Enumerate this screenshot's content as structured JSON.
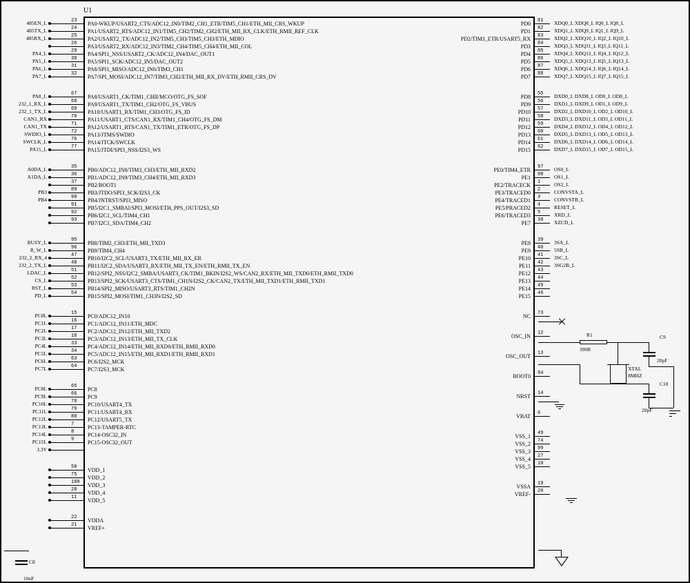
{
  "chip_ref": "U1",
  "left_pins": [
    {
      "net": "485EN_L",
      "pin": "23",
      "label": "PA0-WKUP/USART2_CTS/ADC12_IN0/TIM2_CH1_ETR/TIM5_CH1/ETH_MII_CRS_WKUP"
    },
    {
      "net": "485TX_L",
      "pin": "24",
      "label": "PA1/USART2_RTS/ADC12_IN1/TIM5_CH2/TIM2_CH2/ETH_MII_RX_CLK/ETH_RMII_REF_CLK"
    },
    {
      "net": "485RX_L",
      "pin": "25",
      "label": "PA2/USART2_TX/ADC12_IN2/TIM5_CH3/TIM5_CH3/ETH_MDIO"
    },
    {
      "net": "",
      "pin": "26",
      "label": "PA3/USART2_RX/ADC12_IN3/TIM2_CH4/TIM5_CH4/ETH_MII_COL"
    },
    {
      "net": "PA4_L",
      "pin": "29",
      "label": "PA4/SPI1_NSS/USART2_CK/ADC12_IN4/DAC_OUT1"
    },
    {
      "net": "PA5_L",
      "pin": "30",
      "label": "PA5/SPI1_SCK/ADC12_IN5/DAC_OUT2"
    },
    {
      "net": "PA6_L",
      "pin": "31",
      "label": "PA6/SPI1_MISO/ADC12_IN6/TIM3_CH1"
    },
    {
      "net": "PA7_L",
      "pin": "32",
      "label": "PA7/SPI_MOSI/ADC12_IN7/TIM3_CH2/ETH_MII_RX_DV/ETH_RMII_CRS_DV"
    },
    {
      "gap": true
    },
    {
      "net": "PA8_L",
      "pin": "67",
      "label": "PA8/USART1_CK/TIM1_CHII/MCO/OTG_FS_SOF"
    },
    {
      "net": "232_1_RX_L",
      "pin": "68",
      "label": "PA9/USART1_TX/TIM1_CH2/OTG_FS_VBUS"
    },
    {
      "net": "232_1_TX_L",
      "pin": "69",
      "label": "PA10/USART1_RX/TIM1_CH3/OTG_FS_ID"
    },
    {
      "net": "CAN1_RX",
      "pin": "70",
      "label": "PA11/USART1_CTS/CAN1_RX/TIM1_CH4/OTG_FS_DM"
    },
    {
      "net": "CAN1_TX",
      "pin": "71",
      "label": "PA12/USART1_RTS/CAN1_TX/TIM1_ETR/OTG_FS_DP"
    },
    {
      "net": "SWDIO_L",
      "pin": "72",
      "label": "PA13/JTMS/SWDIO"
    },
    {
      "net": "SWCLK_L",
      "pin": "76",
      "label": "PA14/JTCK/SWCLK"
    },
    {
      "net": "PA15_L",
      "pin": "77",
      "label": "PA15/JTDI/SPI3_NSS/I2S3_WS"
    },
    {
      "gap": true
    },
    {
      "net": "A0DA_L",
      "pin": "35",
      "label": "PB0/ADC12_IN8/TIM3_CH3/ETH_MII_RXD2"
    },
    {
      "net": "A1DA_L",
      "pin": "36",
      "label": "PB1/ADC12_IN9/TIM3_CH4/ETH_MII_RXD3"
    },
    {
      "net": "",
      "pin": "37",
      "label": "PB2/BOOT1"
    },
    {
      "net": "PB3",
      "pin": "89",
      "label": "PB3/JTDO/SPI3_SCK/I2S3_CK"
    },
    {
      "net": "PB4",
      "pin": "90",
      "label": "PB4/JNTRST/SPI3_MISO"
    },
    {
      "net": "",
      "pin": "91",
      "label": "PB5/I2C1_SMBAI/SPI3_MOSI/ETH_PPS_OUT/I2S3_SD"
    },
    {
      "net": "",
      "pin": "92",
      "label": "PB6/I2C1_SCL/TIM4_CH1"
    },
    {
      "net": "",
      "pin": "93",
      "label": "PB7/I2C1_SDA/TIM4_CH2"
    },
    {
      "gap": true
    },
    {
      "net": "BUSY_L",
      "pin": "95",
      "label": "PB8/TIM2_CH3/ETH_MII_TXD3"
    },
    {
      "net": "R_W_L",
      "pin": "96",
      "label": "PB9/TIM4_CH4"
    },
    {
      "net": "232_2_RX_4",
      "pin": "47",
      "label": "PB10/I2C2_SCL/USART3_TX/ETH_MII_RX_ER"
    },
    {
      "net": "232_2_TX_L",
      "pin": "48",
      "label": "PB11/I2C2_SDA/USART3_RX/ETH_MII_TX_EN/ETH_RMII_TX_EN"
    },
    {
      "net": "LDAC_L",
      "pin": "51",
      "label": "PB12/SPI2_NSS/I2C2_SMBA/USART3_CK/TIM1_BKIN/I2S2_WS/CAN2_RX/ETH_MII_TXD0/ETH_RMII_TXD0"
    },
    {
      "net": "CS_L",
      "pin": "52",
      "label": "PB13/SPI2_SCK/USART3_CTS/TIM1_CH1N/I2S2_CK/CAN2_TX/ETH_MII_TXD1/ETH_RMII_TXD1"
    },
    {
      "net": "RST_L",
      "pin": "53",
      "label": "PB14/SPI2_MISO/USART3_RTS/TIM1_CH2N"
    },
    {
      "net": "PD_L",
      "pin": "54",
      "label": "PB15/SPI2_MOSI/TIM1_CH3N/I2S2_SD"
    },
    {
      "gap": true
    },
    {
      "net": "PC0L",
      "pin": "15",
      "label": "PC0/ADC12_IN10"
    },
    {
      "net": "PC1L",
      "pin": "16",
      "label": "PC1/ADC12_IN11/ETH_MDC"
    },
    {
      "net": "PC2L",
      "pin": "17",
      "label": "PC2/ADC12_IN12/ETH_MII_TXD2"
    },
    {
      "net": "PC3L",
      "pin": "18",
      "label": "PC3/ADC12_IN13/ETH_MII_TX_CLK"
    },
    {
      "net": "PC4L",
      "pin": "33",
      "label": "PC4/ADC12_IN14/ETH_MII_RXD0/ETH_RMII_RXD0"
    },
    {
      "net": "PC5L",
      "pin": "34",
      "label": "PC5/ADC12_IN15/ETH_MII_RXD1/ETH_RMII_RXD1"
    },
    {
      "net": "PC6L",
      "pin": "63",
      "label": "PC6/I2S2_MCK"
    },
    {
      "net": "PC7L",
      "pin": "64",
      "label": "PC7/I2S3_MCK"
    },
    {
      "gap": true
    },
    {
      "net": "PC8L",
      "pin": "65",
      "label": "PC8"
    },
    {
      "net": "PC9L",
      "pin": "66",
      "label": "PC9"
    },
    {
      "net": "PC10L",
      "pin": "78",
      "label": "PC10/USART4_TX"
    },
    {
      "net": "PC11L",
      "pin": "79",
      "label": "PC11/USART4_RX"
    },
    {
      "net": "PC12L",
      "pin": "80",
      "label": "PC12/USART5_TX"
    },
    {
      "net": "PC13L",
      "pin": "7",
      "label": "PC13-TAMPER-RTC"
    },
    {
      "net": "PC14L",
      "pin": "8",
      "label": "PC14-OSC32_IN"
    },
    {
      "net": "PC15L",
      "pin": "9",
      "label": "PC15-OSC32_OUT"
    },
    {
      "net": "3.3V",
      "pin": "",
      "label": ""
    },
    {
      "gap": true
    },
    {
      "net": "",
      "pin": "50",
      "label": "VDD_1"
    },
    {
      "net": "",
      "pin": "75",
      "label": "VDD_2"
    },
    {
      "net": "",
      "pin": "100",
      "label": "VDD_3"
    },
    {
      "net": "",
      "pin": "28",
      "label": "VDD_4"
    },
    {
      "net": "",
      "pin": "11",
      "label": "VDD_5"
    },
    {
      "gap": true
    },
    {
      "net": "",
      "pin": "22",
      "label": "VDDA"
    },
    {
      "net": "",
      "pin": "21",
      "label": "VREF+"
    }
  ],
  "right_pins": [
    {
      "label": "PD0",
      "pin": "81",
      "ext": "XDQ0_L XDQ8_L  IQ0_L    IQ8_L"
    },
    {
      "label": "PD1",
      "pin": "82",
      "ext": "XDQ1_L XDQ9_L  IQ1_L    IQ9_L"
    },
    {
      "label": "PD2/TIM3_ETR/USART5_RX",
      "pin": "83",
      "ext": "XDQ2_L XDQ10_L IQ2_L    IQ10_L"
    },
    {
      "label": "PD3",
      "pin": "84",
      "ext": "XDQ3_L XDQ11_L IQ3_L    IQ11_L"
    },
    {
      "label": "PD4",
      "pin": "85",
      "ext": "XDQ4_L XDQ12_L IQ4_L    IQ12_L"
    },
    {
      "label": "PD5",
      "pin": "86",
      "ext": "XDQ5_L XDQ13_L IQ5_L    IQ13_L"
    },
    {
      "label": "PD6",
      "pin": "87",
      "ext": "XDQ6_L XDQ14_L IQ6_L    IQ14_L"
    },
    {
      "label": "PD7",
      "pin": "88",
      "ext": "XDQ7_L XDQ15_L IQ7_L    IQ15_L"
    },
    {
      "gap": true
    },
    {
      "label": "PD8",
      "pin": "55",
      "ext": "DXD0_L  DXD8_L  OD0_L  OD8_L"
    },
    {
      "label": "PD9",
      "pin": "56",
      "ext": "DXD1_L  DXD9_L  OD1_L  OD9_L"
    },
    {
      "label": "PD10",
      "pin": "57",
      "ext": "DXD2_L  DXD10_L OD2_L  OD10_L"
    },
    {
      "label": "PD11",
      "pin": "58",
      "ext": "DXD3_L  DXD11_L OD3_L  OD11_L"
    },
    {
      "label": "PD12",
      "pin": "59",
      "ext": "DXD4_L  DXD12_L OD4_L  OD12_L"
    },
    {
      "label": "PD13",
      "pin": "60",
      "ext": "DXD5_L  DXD13_L OD5_L  OD13_L"
    },
    {
      "label": "PD14",
      "pin": "61",
      "ext": "DXD6_L  DXD14_L OD6_L  OD14_L"
    },
    {
      "label": "PD15",
      "pin": "62",
      "ext": "DXD7_L  DXD15_L OD7_L  OD15_L"
    },
    {
      "gap": true
    },
    {
      "label": "PE0/TIM4_ETR",
      "pin": "97",
      "ext": "OS0_L"
    },
    {
      "label": "PE1",
      "pin": "98",
      "ext": "OS1_L"
    },
    {
      "label": "PE2/TRACECK",
      "pin": "1",
      "ext": "OS2_L"
    },
    {
      "label": "PE3/TRACED0",
      "pin": "2",
      "ext": "CONVSTA_L"
    },
    {
      "label": "PE4/TRACED1",
      "pin": "3",
      "ext": "CONVSTB_L"
    },
    {
      "label": "PE5/PRACED2",
      "pin": "4",
      "ext": "RESET_L"
    },
    {
      "label": "PE6/TRACED3",
      "pin": "5",
      "ext": "XRD_L"
    },
    {
      "label": "PE7",
      "pin": "38",
      "ext": "XZCD_L"
    },
    {
      "gap": true
    },
    {
      "label": "PE8",
      "pin": "39",
      "ext": "3SA_L"
    },
    {
      "label": "PE9",
      "pin": "40",
      "ext": "5SB_L"
    },
    {
      "label": "PE10",
      "pin": "41",
      "ext": "3SC_L"
    },
    {
      "label": "PE11",
      "pin": "42",
      "ext": "3SG2B_L"
    },
    {
      "label": "PE12",
      "pin": "43",
      "ext": ""
    },
    {
      "label": "PE13",
      "pin": "44",
      "ext": ""
    },
    {
      "label": "PE14",
      "pin": "45",
      "ext": ""
    },
    {
      "label": "PE15",
      "pin": "46",
      "ext": ""
    },
    {
      "gap": true
    },
    {
      "label": "NC",
      "pin": "73",
      "ext": ""
    },
    {
      "gap": true
    },
    {
      "label": "OSC_IN",
      "pin": "12",
      "ext": ""
    },
    {
      "gap": true
    },
    {
      "label": "OSC_OUT",
      "pin": "13",
      "ext": ""
    },
    {
      "gap": true
    },
    {
      "label": "BOOT0",
      "pin": "94",
      "ext": ""
    },
    {
      "gap": true
    },
    {
      "label": "NRST",
      "pin": "14",
      "ext": ""
    },
    {
      "gap": true
    },
    {
      "label": "VBAT",
      "pin": "6",
      "ext": ""
    },
    {
      "gap": true
    },
    {
      "label": "VSS_1",
      "pin": "49",
      "ext": ""
    },
    {
      "label": "VSS_2",
      "pin": "74",
      "ext": ""
    },
    {
      "label": "VSS_3",
      "pin": "99",
      "ext": ""
    },
    {
      "label": "VSS_4",
      "pin": "27",
      "ext": ""
    },
    {
      "label": "VSS_5",
      "pin": "10",
      "ext": ""
    },
    {
      "gap": true
    },
    {
      "label": "VSSA",
      "pin": "19",
      "ext": ""
    },
    {
      "label": "VREF-",
      "pin": "20",
      "ext": ""
    }
  ],
  "components": {
    "R1": {
      "ref": "R1",
      "value": "390R"
    },
    "XTAL": {
      "ref": "XTAL",
      "value": "8MHZ"
    },
    "C9": {
      "ref": "C9",
      "value": "20pF"
    },
    "C10": {
      "ref": "C10",
      "value": "20pF"
    },
    "C8": {
      "ref": "C8",
      "value": "10nF"
    }
  }
}
